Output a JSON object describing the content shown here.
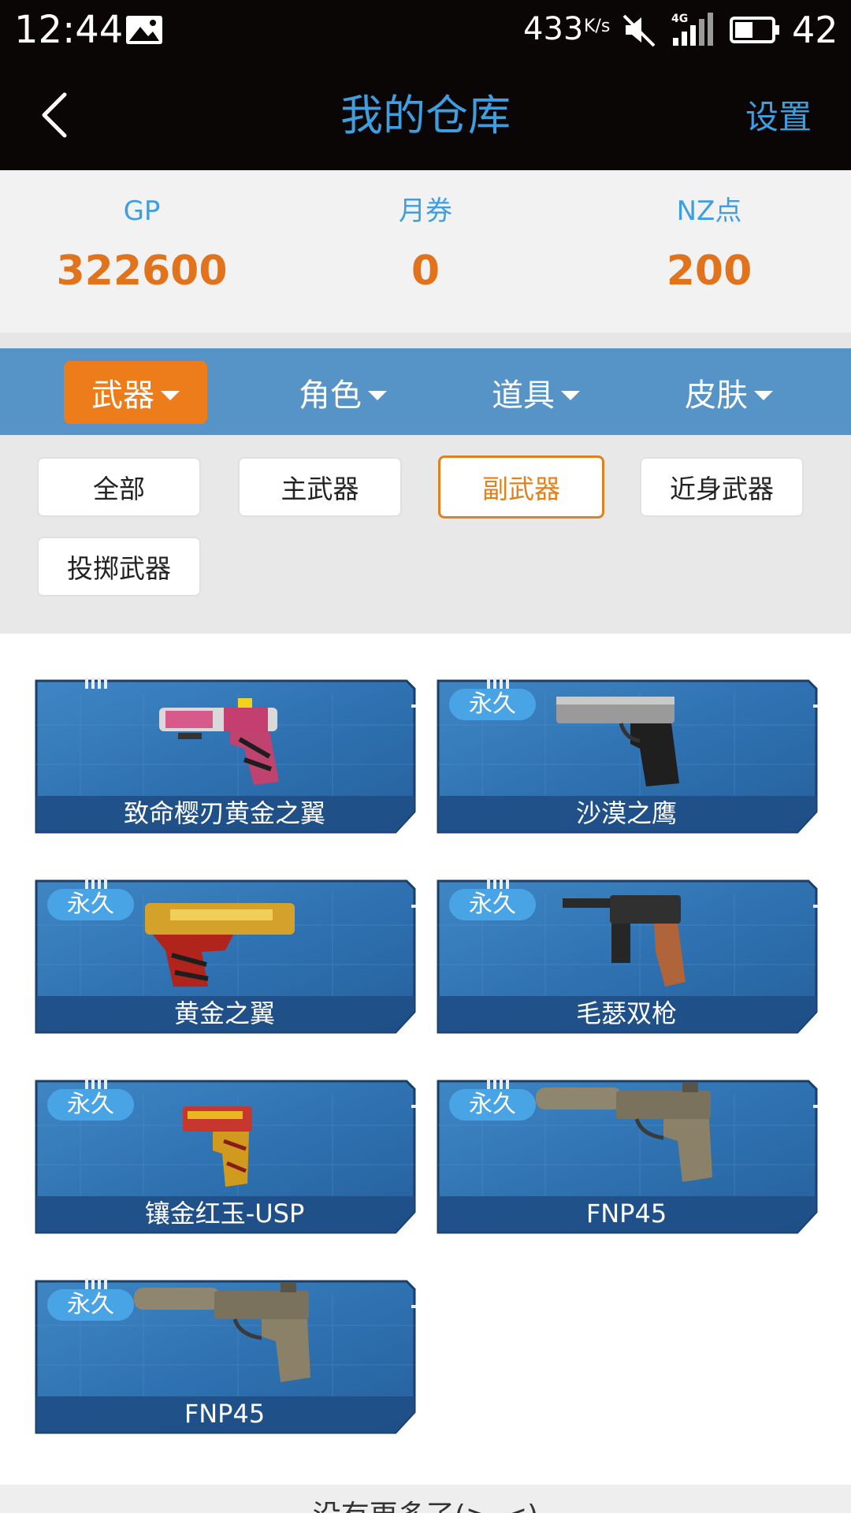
{
  "status_bar": {
    "time": "12:44",
    "net_speed": "433",
    "net_speed_unit": "K/s",
    "battery_level": "42",
    "icons": [
      "gallery-icon",
      "mute-icon",
      "signal-4g-icon",
      "battery-icon"
    ]
  },
  "header": {
    "title": "我的仓库",
    "settings_label": "设置"
  },
  "currency": [
    {
      "label": "GP",
      "value": "322600"
    },
    {
      "label": "月券",
      "value": "0"
    },
    {
      "label": "NZ点",
      "value": "200"
    }
  ],
  "categories": [
    {
      "label": "武器",
      "active": true
    },
    {
      "label": "角色",
      "active": false
    },
    {
      "label": "道具",
      "active": false
    },
    {
      "label": "皮肤",
      "active": false
    }
  ],
  "filters": [
    {
      "label": "全部",
      "active": false
    },
    {
      "label": "主武器",
      "active": false
    },
    {
      "label": "副武器",
      "active": true
    },
    {
      "label": "近身武器",
      "active": false
    },
    {
      "label": "投掷武器",
      "active": false
    }
  ],
  "permanent_label": "永久",
  "items": [
    {
      "name": "致命樱刃黄金之翼",
      "permanent": false,
      "icon": "pink-gold-pistol-icon"
    },
    {
      "name": "沙漠之鹰",
      "permanent": true,
      "icon": "desert-eagle-icon"
    },
    {
      "name": "黄金之翼",
      "permanent": true,
      "icon": "golden-wing-pistol-icon"
    },
    {
      "name": "毛瑟双枪",
      "permanent": true,
      "icon": "mauser-pistol-icon"
    },
    {
      "name": "镶金红玉-USP",
      "permanent": true,
      "icon": "usp-pistol-icon"
    },
    {
      "name": "FNP45",
      "permanent": true,
      "icon": "fnp45-pistol-icon"
    },
    {
      "name": "FNP45",
      "permanent": true,
      "icon": "fnp45-pistol-icon"
    }
  ],
  "footer": {
    "text": "没有更多了(>_<)"
  },
  "colors": {
    "accent_blue": "#3f9ee0",
    "accent_orange": "#ec7d1a",
    "category_bar": "#5693c6",
    "card_blue": "#2e6fae"
  }
}
